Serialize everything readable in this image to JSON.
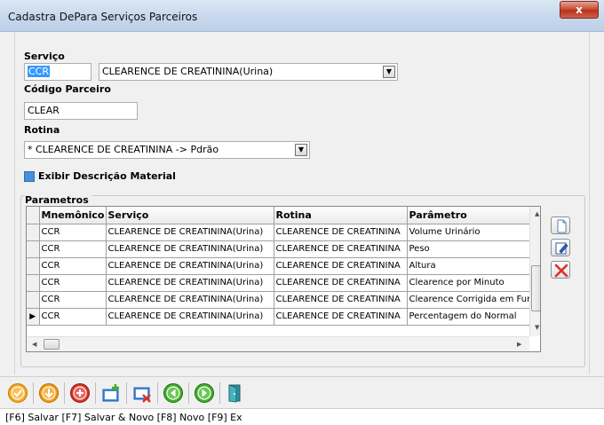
{
  "window": {
    "title": "Cadastra DePara Serviços Parceiros",
    "close_glyph": "x"
  },
  "form": {
    "servico_label": "Serviço",
    "servico_code": "CCR",
    "servico_selected": "CLEARENCE DE CREATININA(Urina)",
    "codigo_parceiro_label": "Código Parceiro",
    "codigo_parceiro_value": "CLEAR",
    "rotina_label": "Rotina",
    "rotina_selected": "* CLEARENCE DE CREATININA -> Pdrão",
    "exibir_label": "Exibir Descrição Material",
    "exibir_checked": true
  },
  "parametros": {
    "title": "Parametros",
    "columns": [
      "Mnemônico",
      "Serviço",
      "Rotina",
      "Parâmetro"
    ],
    "rows": [
      {
        "mnemonico": "CCR",
        "servico": "CLEARENCE DE CREATININA(Urina)",
        "rotina": "CLEARENCE DE CREATININA",
        "parametro": "Volume Urinário"
      },
      {
        "mnemonico": "CCR",
        "servico": "CLEARENCE DE CREATININA(Urina)",
        "rotina": "CLEARENCE DE CREATININA",
        "parametro": "Peso"
      },
      {
        "mnemonico": "CCR",
        "servico": "CLEARENCE DE CREATININA(Urina)",
        "rotina": "CLEARENCE DE CREATININA",
        "parametro": "Altura"
      },
      {
        "mnemonico": "CCR",
        "servico": "CLEARENCE DE CREATININA(Urina)",
        "rotina": "CLEARENCE DE CREATININA",
        "parametro": "Clearence por Minuto"
      },
      {
        "mnemonico": "CCR",
        "servico": "CLEARENCE DE CREATININA(Urina)",
        "rotina": "CLEARENCE DE CREATININA",
        "parametro": "Clearence Corrigida em Fur"
      },
      {
        "mnemonico": "CCR",
        "servico": "CLEARENCE DE CREATININA(Urina)",
        "rotina": "CLEARENCE DE CREATININA",
        "parametro": "Percentagem do Normal"
      }
    ],
    "current_row_indicator": "▶",
    "side_buttons": [
      "new-record-icon",
      "edit-record-icon",
      "delete-record-icon"
    ]
  },
  "toolbar": {
    "icons": [
      "save-icon",
      "save-and-new-icon",
      "new-icon",
      "add-folder-icon",
      "remove-folder-icon",
      "previous-icon",
      "next-icon",
      "exit-door-icon"
    ]
  },
  "status": {
    "text": "[F6] Salvar [F7] Salvar & Novo [F8] Novo [F9] Ex"
  },
  "colors": {
    "accent": "#3399ff",
    "orange": "#f39c12",
    "red": "#d9322b",
    "green": "#3fae2a",
    "teal": "#2f8f9d"
  }
}
